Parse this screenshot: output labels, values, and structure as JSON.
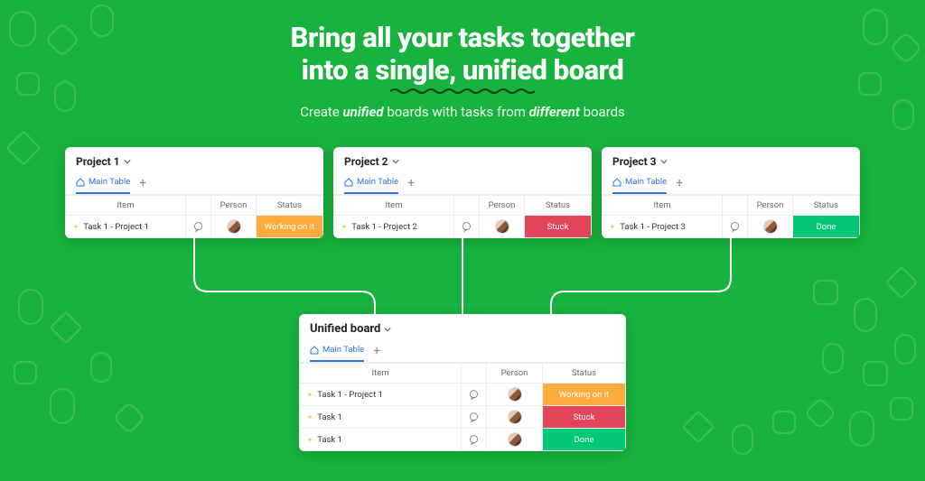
{
  "header": {
    "title_line1": "Bring all your tasks together",
    "title_line2": "into a single, unified board",
    "sub_pre": "Create ",
    "sub_em1": "unified",
    "sub_mid": " boards with tasks from ",
    "sub_em2": "different",
    "sub_post": " boards"
  },
  "common": {
    "main_table": "Main Table",
    "plus": "+",
    "col_item": "Item",
    "col_person": "Person",
    "col_status": "Status"
  },
  "boards": {
    "p1": {
      "title": "Project 1",
      "task": "Task 1 - Project 1",
      "status": "Working on it",
      "status_class": "st-working"
    },
    "p2": {
      "title": "Project 2",
      "task": "Task 1 - Project 2",
      "status": "Stuck",
      "status_class": "st-stuck"
    },
    "p3": {
      "title": "Project 3",
      "task": "Task 1 - Project 3",
      "status": "Done",
      "status_class": "st-done"
    }
  },
  "unified": {
    "title": "Unified board",
    "rows": [
      {
        "task": "Task 1 - Project 1",
        "status": "Working on it",
        "status_class": "st-working"
      },
      {
        "task": "Task 1",
        "status": "Stuck",
        "status_class": "st-stuck"
      },
      {
        "task": "Task 1",
        "status": "Done",
        "status_class": "st-done"
      }
    ]
  }
}
